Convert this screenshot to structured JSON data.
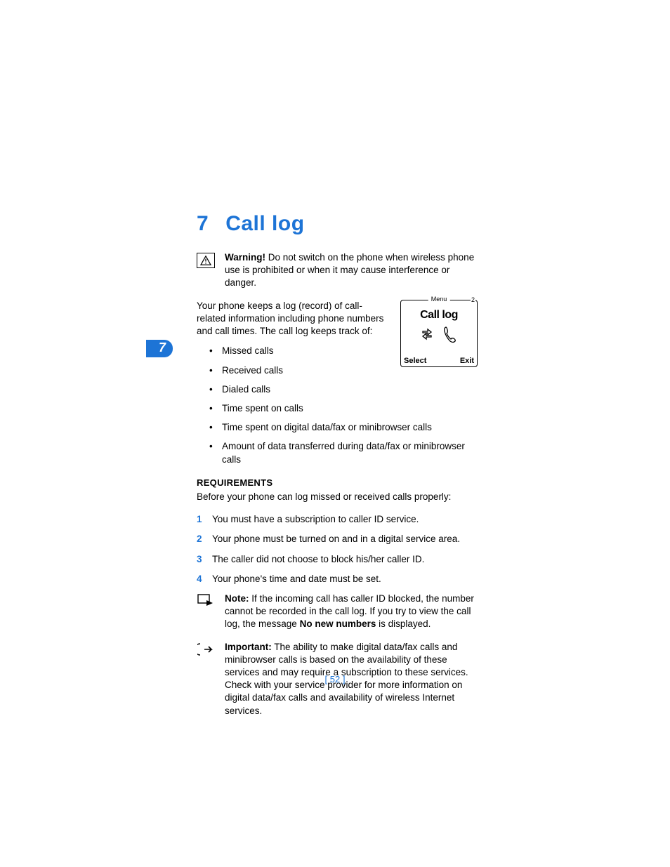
{
  "chapter": {
    "number": "7",
    "title": "Call log"
  },
  "sideTab": "7",
  "warning": {
    "label": "Warning!",
    "text": "Do not switch on the phone when wireless phone use is prohibited or when it may cause interference or danger."
  },
  "intro": "Your phone keeps a log (record) of call-related information including phone numbers and call times. The call log keeps track of:",
  "phone": {
    "menu": "Menu",
    "corner": "2",
    "title": "Call log",
    "softLeft": "Select",
    "softRight": "Exit"
  },
  "bullets": [
    "Missed calls",
    "Received calls",
    "Dialed calls",
    "Time spent on calls",
    "Time spent on digital data/fax or minibrowser calls",
    "Amount of data transferred during data/fax or minibrowser calls"
  ],
  "requirements": {
    "heading": "REQUIREMENTS",
    "intro": "Before your phone can log missed or received calls properly:",
    "items": [
      {
        "n": "1",
        "text": "You must have a subscription to caller ID service."
      },
      {
        "n": "2",
        "text": "Your phone must be turned on and in a digital service area."
      },
      {
        "n": "3",
        "text": "The caller did not choose to block his/her caller ID."
      },
      {
        "n": "4",
        "text": "Your phone's time and date must be set."
      }
    ]
  },
  "note": {
    "label": "Note:",
    "pre": "If the incoming call has caller ID blocked, the number cannot be recorded in the call log. If you try to view the call log, the message ",
    "bold": "No new numbers",
    "post": " is displayed."
  },
  "important": {
    "label": "Important:",
    "text": "The ability to make digital data/fax calls and minibrowser calls is based on the availability of these services and may require a subscription to these services. Check with your service provider for more information on digital data/fax calls and availability of wireless Internet services."
  },
  "pageNumber": "[ 52 ]"
}
